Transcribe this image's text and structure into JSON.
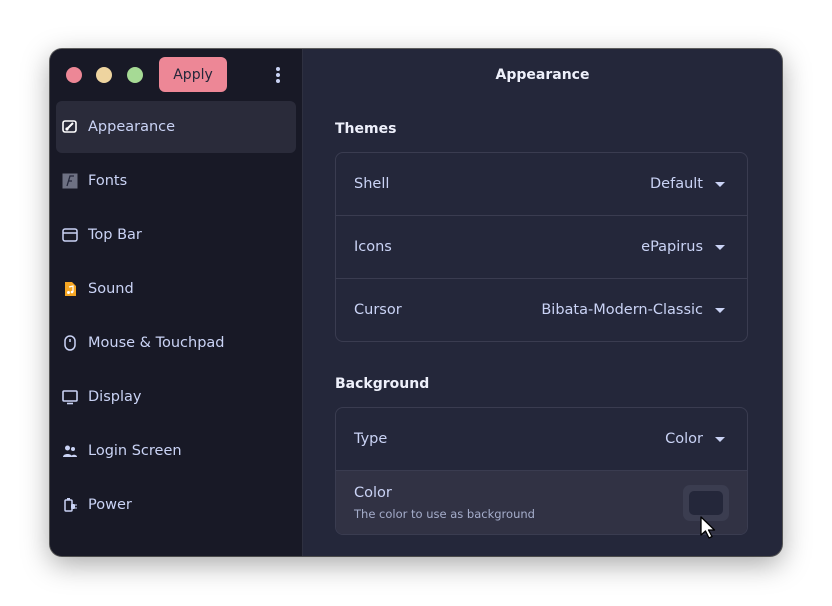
{
  "window": {
    "title": "Appearance",
    "apply_label": "Apply"
  },
  "colors": {
    "accent": "#ed8796",
    "sidebar_bg": "#181926",
    "content_bg": "#24273a",
    "text": "#cad3f5"
  },
  "sidebar": {
    "items": [
      {
        "label": "Appearance",
        "icon": "appearance-icon",
        "active": true
      },
      {
        "label": "Fonts",
        "icon": "fonts-icon"
      },
      {
        "label": "Top Bar",
        "icon": "top-bar-icon"
      },
      {
        "label": "Sound",
        "icon": "sound-icon"
      },
      {
        "label": "Mouse & Touchpad",
        "icon": "mouse-icon"
      },
      {
        "label": "Display",
        "icon": "display-icon"
      },
      {
        "label": "Login Screen",
        "icon": "users-icon"
      },
      {
        "label": "Power",
        "icon": "power-plug-icon"
      }
    ]
  },
  "themes": {
    "title": "Themes",
    "rows": [
      {
        "label": "Shell",
        "value": "Default"
      },
      {
        "label": "Icons",
        "value": "ePapirus"
      },
      {
        "label": "Cursor",
        "value": "Bibata-Modern-Classic"
      }
    ]
  },
  "background": {
    "title": "Background",
    "type": {
      "label": "Type",
      "value": "Color"
    },
    "color": {
      "label": "Color",
      "subtitle": "The color to use as background",
      "swatch": "#24273a"
    }
  }
}
